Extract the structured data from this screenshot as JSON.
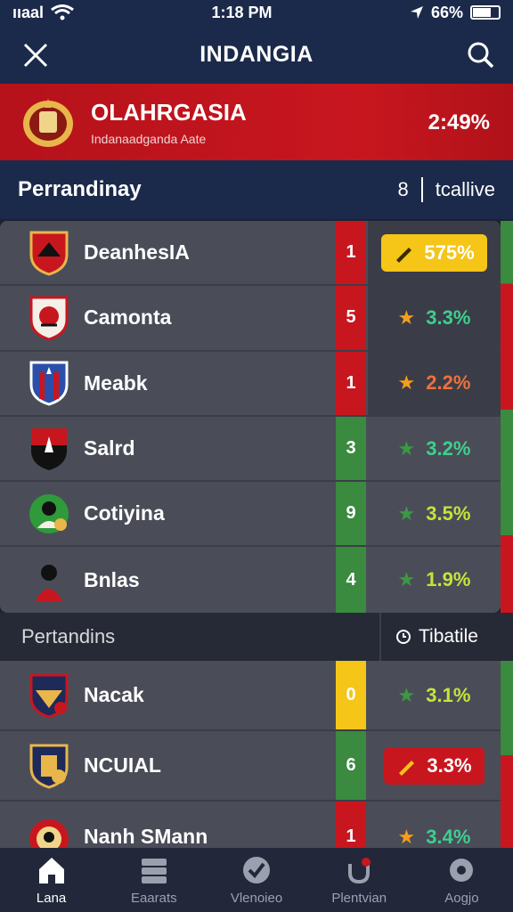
{
  "status": {
    "carrier": "ııaal",
    "time": "1:18 PM",
    "battery": "66%"
  },
  "header": {
    "title": "INDANGIA"
  },
  "banner": {
    "title": "OLAHRGASIA",
    "subtitle": "Indanaadganda Aate",
    "percent": "2:49%"
  },
  "section1": {
    "title": "Perrandinay",
    "right_num": "8",
    "right_label": "tcallive"
  },
  "rows1": [
    {
      "name": "DeanhesIA",
      "num": "1",
      "stat": "575%",
      "num_color": "#c8161f"
    },
    {
      "name": "Camonta",
      "num": "5",
      "stat": "3.3%",
      "num_color": "#c8161f"
    },
    {
      "name": "Meabk",
      "num": "1",
      "stat": "2.2%",
      "num_color": "#c8161f"
    },
    {
      "name": "Salrd",
      "num": "3",
      "stat": "3.2%",
      "num_color": "#3a8a3f"
    },
    {
      "name": "Cotiyina",
      "num": "9",
      "stat": "3.5%",
      "num_color": "#3a8a3f"
    },
    {
      "name": "Bnlas",
      "num": "4",
      "stat": "1.9%",
      "num_color": "#3a8a3f"
    }
  ],
  "section2": {
    "title": "Pertandins",
    "right_label": "Tibatile"
  },
  "rows2": [
    {
      "name": "Nacak",
      "num": "0",
      "stat": "3.1%",
      "num_color": "#f5c518"
    },
    {
      "name": "NCUIAL",
      "num": "6",
      "stat": "3.3%",
      "num_color": "#3a8a3f"
    },
    {
      "name": "Nanh SMann",
      "num": "1",
      "stat": "3.4%",
      "num_color": "#c8161f"
    }
  ],
  "tabs": [
    {
      "label": "Lana",
      "icon": "home-icon"
    },
    {
      "label": "Eaarats",
      "icon": "news-icon"
    },
    {
      "label": "Vlenoieo",
      "icon": "check-icon"
    },
    {
      "label": "Plentvian",
      "icon": "alert-icon"
    },
    {
      "label": "Aogjo",
      "icon": "settings-icon"
    }
  ],
  "colors": {
    "accent_red": "#c8161f",
    "accent_green": "#3a8a3f",
    "accent_yellow": "#f5c518",
    "header_bg": "#1b2a4a"
  }
}
